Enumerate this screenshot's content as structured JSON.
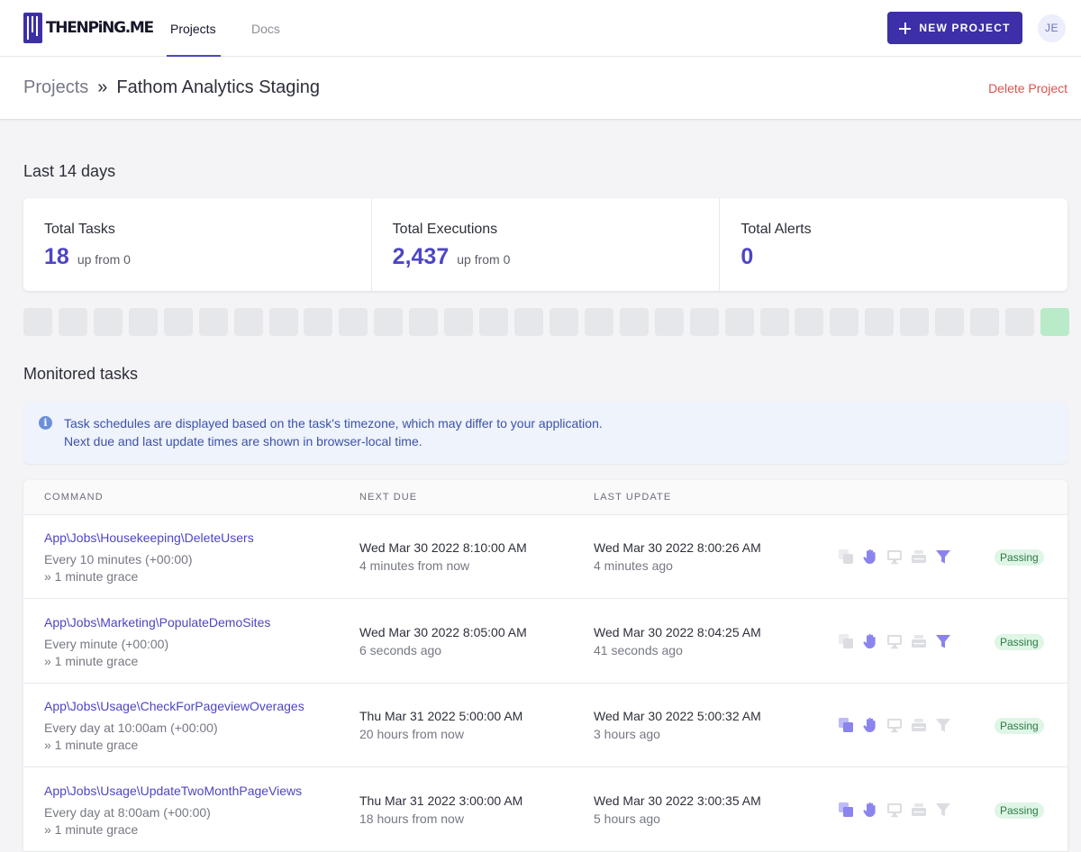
{
  "nav": {
    "logo_text": "THENPiNG.ME",
    "links": [
      {
        "label": "Projects",
        "active": true
      },
      {
        "label": "Docs",
        "active": false
      }
    ],
    "new_project_label": "NEW PROJECT",
    "avatar_initials": "JE"
  },
  "header": {
    "breadcrumb_root": "Projects",
    "breadcrumb_sep": "»",
    "breadcrumb_current": "Fathom Analytics Staging",
    "delete_label": "Delete Project"
  },
  "stats": {
    "title": "Last 14 days",
    "items": [
      {
        "label": "Total Tasks",
        "value": "18",
        "sub": "up from 0"
      },
      {
        "label": "Total Executions",
        "value": "2,437",
        "sub": "up from 0"
      },
      {
        "label": "Total Alerts",
        "value": "0",
        "sub": ""
      }
    ]
  },
  "heatmap": {
    "cells": [
      "empty",
      "empty",
      "empty",
      "empty",
      "empty",
      "empty",
      "empty",
      "empty",
      "empty",
      "empty",
      "empty",
      "empty",
      "empty",
      "empty",
      "empty",
      "empty",
      "empty",
      "empty",
      "empty",
      "empty",
      "empty",
      "empty",
      "empty",
      "empty",
      "empty",
      "empty",
      "empty",
      "empty",
      "empty",
      "ok"
    ],
    "colors": {
      "empty": "#e6e7eb",
      "ok": "#b9ebc8"
    }
  },
  "monitored": {
    "title": "Monitored tasks",
    "info_lines": [
      "Task schedules are displayed based on the task's timezone, which may differ to your application.",
      "Next due and last update times are shown in browser-local time."
    ]
  },
  "table": {
    "columns": [
      "COMMAND",
      "NEXT DUE",
      "LAST UPDATE"
    ],
    "rows": [
      {
        "command": "App\\Jobs\\Housekeeping\\DeleteUsers",
        "schedule": "Every 10 minutes (+00:00)",
        "grace": "» 1 minute grace",
        "next_due": "Wed Mar 30 2022 8:10:00 AM",
        "next_due_rel": "4 minutes from now",
        "last_update": "Wed Mar 30 2022 8:00:26 AM",
        "last_update_rel": "4 minutes ago",
        "status": "Passing",
        "icons": [
          {
            "name": "overlap-icon",
            "active": false
          },
          {
            "name": "hand-icon",
            "active": true
          },
          {
            "name": "monitor-icon",
            "active": false
          },
          {
            "name": "server-icon",
            "active": false
          },
          {
            "name": "filter-icon",
            "active": true
          }
        ]
      },
      {
        "command": "App\\Jobs\\Marketing\\PopulateDemoSites",
        "schedule": "Every minute (+00:00)",
        "grace": "» 1 minute grace",
        "next_due": "Wed Mar 30 2022 8:05:00 AM",
        "next_due_rel": "6 seconds ago",
        "last_update": "Wed Mar 30 2022 8:04:25 AM",
        "last_update_rel": "41 seconds ago",
        "status": "Passing",
        "icons": [
          {
            "name": "overlap-icon",
            "active": false
          },
          {
            "name": "hand-icon",
            "active": true
          },
          {
            "name": "monitor-icon",
            "active": false
          },
          {
            "name": "server-icon",
            "active": false
          },
          {
            "name": "filter-icon",
            "active": true
          }
        ]
      },
      {
        "command": "App\\Jobs\\Usage\\CheckForPageviewOverages",
        "schedule": "Every day at 10:00am (+00:00)",
        "grace": "» 1 minute grace",
        "next_due": "Thu Mar 31 2022 5:00:00 AM",
        "next_due_rel": "20 hours from now",
        "last_update": "Wed Mar 30 2022 5:00:32 AM",
        "last_update_rel": "3 hours ago",
        "status": "Passing",
        "icons": [
          {
            "name": "overlap-icon",
            "active": true
          },
          {
            "name": "hand-icon",
            "active": true
          },
          {
            "name": "monitor-icon",
            "active": false
          },
          {
            "name": "server-icon",
            "active": false
          },
          {
            "name": "filter-icon",
            "active": false
          }
        ]
      },
      {
        "command": "App\\Jobs\\Usage\\UpdateTwoMonthPageViews",
        "schedule": "Every day at 8:00am (+00:00)",
        "grace": "» 1 minute grace",
        "next_due": "Thu Mar 31 2022 3:00:00 AM",
        "next_due_rel": "18 hours from now",
        "last_update": "Wed Mar 30 2022 3:00:35 AM",
        "last_update_rel": "5 hours ago",
        "status": "Passing",
        "icons": [
          {
            "name": "overlap-icon",
            "active": true
          },
          {
            "name": "hand-icon",
            "active": true
          },
          {
            "name": "monitor-icon",
            "active": false
          },
          {
            "name": "server-icon",
            "active": false
          },
          {
            "name": "filter-icon",
            "active": false
          }
        ]
      }
    ]
  },
  "colors": {
    "brand": "#3c2fa8",
    "accent": "#4d45c5",
    "icon_active": "#8b84ee",
    "icon_inactive": "#dcdde2",
    "danger": "#d9534f",
    "passing_bg": "#dff5e6",
    "passing_text": "#2f7a45"
  }
}
